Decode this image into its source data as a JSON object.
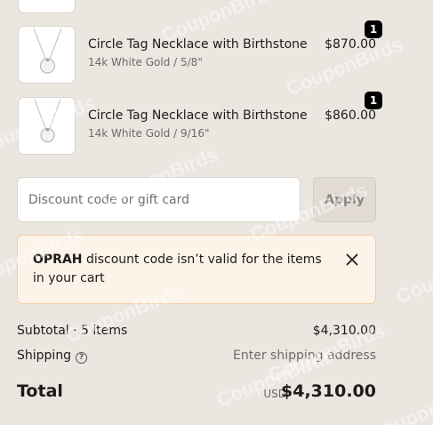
{
  "items": [
    {
      "quantity": "1",
      "name": "Circle Tag Necklace with Birthstone",
      "variant": "14k White Gold / 5/8\"",
      "price": "$870.00"
    },
    {
      "quantity": "1",
      "name": "Circle Tag Necklace with Birthstone",
      "variant": "14k White Gold / 9/16\"",
      "price": "$860.00"
    }
  ],
  "discount": {
    "placeholder": "Discount code or gift card",
    "apply_label": "Apply"
  },
  "alert": {
    "code": "OPRAH",
    "message": " discount code isn’t valid for the items in your cart"
  },
  "summary": {
    "subtotal_label": "Subtotal · 5 items",
    "subtotal_value": "$4,310.00",
    "shipping_label": "Shipping",
    "shipping_value": "Enter shipping address",
    "total_label": "Total",
    "currency": "USD",
    "total_value": "$4,310.00"
  },
  "watermark": "CouponBirds",
  "colors": {
    "background": "#ece6e0",
    "alert_background": "#fdf3e8",
    "alert_border": "#f2cfa6",
    "badge": "#000000"
  }
}
